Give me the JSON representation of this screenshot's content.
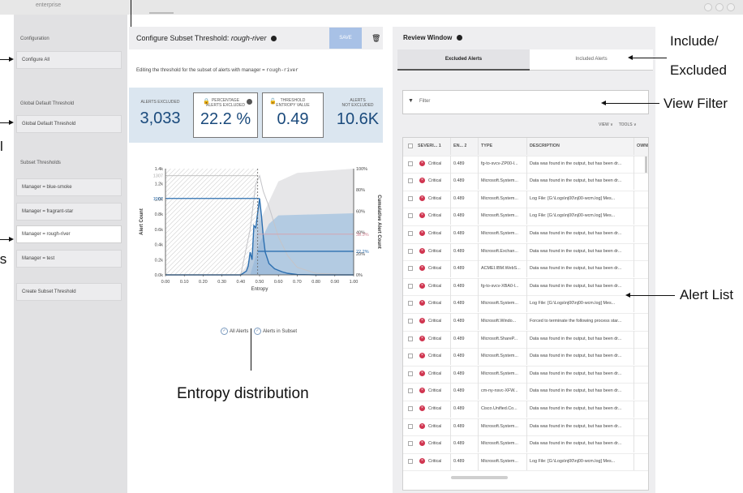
{
  "brand": "enterprise",
  "sidebar": {
    "config_heading": "Configuration",
    "configure_all": "Configure All",
    "global_heading": "Global Default Threshold",
    "global_button": "Global Default Threshold",
    "subset_heading": "Subset Thresholds",
    "subsets": [
      "Manager = blue-smoke",
      "Manager = fragrant-star",
      "Manager = rough-river",
      "Manager = test"
    ],
    "create_subset": "Create Subset Threshold"
  },
  "main": {
    "title_prefix": "Configure Subset Threshold:",
    "title_subset": "rough-river",
    "save_label": "SAVE",
    "editing_text": "Editing the threshold for the subset of alerts with manager =",
    "editing_value": "rough-river",
    "stats": {
      "alerts_excluded_label": "ALERTS EXCLUDED",
      "alerts_excluded_value": "3,033",
      "percentage_label_1": "PERCENTAGE",
      "percentage_label_2": "ALERTS EXCLUDED",
      "percentage_value": "22.2 %",
      "threshold_label_1": "THRESHOLD",
      "threshold_label_2": "ENTROPY VALUE",
      "threshold_value": "0.49",
      "not_excluded_label_1": "ALERTS",
      "not_excluded_label_2": "NOT EXCLUDED",
      "not_excluded_value": "10.6K"
    },
    "legend": {
      "all_alerts": "All Alerts",
      "alerts_in_subset": "Alerts in Subset"
    }
  },
  "chart_data": {
    "type": "area",
    "xlabel": "Entropy",
    "ylabel_left": "Alert Count",
    "ylabel_right": "Cumulative Alert Count",
    "x_ticks": [
      "0.00",
      "0.10",
      "0.20",
      "0.30",
      "0.40",
      "0.50",
      "0.60",
      "0.70",
      "0.80",
      "0.90",
      "1.00"
    ],
    "y_ticks_left": [
      "0.0k",
      "0.2k",
      "0.4k",
      "0.6k",
      "0.8k",
      "1.0k",
      "1.2k",
      "1.4k"
    ],
    "y_ticks_right": [
      "0%",
      "20%",
      "40%",
      "60%",
      "80%",
      "100%"
    ],
    "ylim_left": [
      0,
      1400
    ],
    "ylim_right": [
      0,
      100
    ],
    "xlim": [
      0,
      1
    ],
    "threshold_x": 0.49,
    "markers": {
      "left_1": "1307",
      "left_2": "1007",
      "right_1": "38.3%",
      "right_2": "22.2%"
    },
    "series": [
      {
        "name": "Alerts in Subset",
        "x": [
          0.0,
          0.4,
          0.43,
          0.44,
          0.45,
          0.46,
          0.47,
          0.48,
          0.49,
          0.5,
          0.51,
          0.52,
          0.53,
          0.55,
          0.58,
          0.62,
          0.65,
          0.7,
          0.8,
          1.0
        ],
        "values": [
          0,
          0,
          50,
          120,
          300,
          200,
          650,
          620,
          820,
          1007,
          780,
          500,
          300,
          150,
          80,
          40,
          20,
          5,
          0,
          0
        ]
      },
      {
        "name": "All Alerts",
        "x": [
          0.0,
          0.4,
          0.45,
          0.48,
          0.5,
          0.52,
          0.55,
          0.6,
          0.65,
          0.7,
          0.8,
          1.0
        ],
        "values": [
          0,
          0,
          600,
          1200,
          1307,
          1100,
          900,
          500,
          250,
          100,
          20,
          0
        ]
      }
    ]
  },
  "review": {
    "title": "Review Window",
    "tab_excluded": "Excluded Alerts",
    "tab_included": "Included Alerts",
    "filter_placeholder": "Filter",
    "view_label": "VIEW",
    "tools_label": "TOOLS",
    "columns": [
      "SEVERI... 1",
      "EN... 2",
      "TYPE",
      "DESCRIPTION",
      "OWNED"
    ],
    "rows": [
      {
        "sev": "Critical",
        "en": "0.489",
        "type": "fg-to-svcv-ZP00-l...",
        "desc": "Data was found in the output, but has been dr..."
      },
      {
        "sev": "Critical",
        "en": "0.489",
        "type": "Microsoft.System...",
        "desc": "Data was found in the output, but has been dr..."
      },
      {
        "sev": "Critical",
        "en": "0.489",
        "type": "Microsoft.System...",
        "desc": "Log File: [G:\\Logs\\nj00\\nj00-wcm.log] Mes..."
      },
      {
        "sev": "Critical",
        "en": "0.489",
        "type": "Microsoft.System...",
        "desc": "Log File: [G:\\Logs\\nj00\\nj00-wcm.log] Mes..."
      },
      {
        "sev": "Critical",
        "en": "0.489",
        "type": "Microsoft.System...",
        "desc": "Data was found in the output, but has been dr..."
      },
      {
        "sev": "Critical",
        "en": "0.489",
        "type": "Microsoft.Exchan...",
        "desc": "Data was found in the output, but has been dr..."
      },
      {
        "sev": "Critical",
        "en": "0.489",
        "type": "ACMEI.IBM.WebS...",
        "desc": "Data was found in the output, but has been dr..."
      },
      {
        "sev": "Critical",
        "en": "0.489",
        "type": "fg-to-svcv-XBA0-l...",
        "desc": "Data was found in the output, but has been dr..."
      },
      {
        "sev": "Critical",
        "en": "0.489",
        "type": "Microsoft.System...",
        "desc": "Log File: [G:\\Logs\\nj00\\nj00-wcm.log] Mes..."
      },
      {
        "sev": "Critical",
        "en": "0.489",
        "type": "Microsoft.Windo...",
        "desc": "Forced to terminate the following process star..."
      },
      {
        "sev": "Critical",
        "en": "0.489",
        "type": "Microsoft.ShareP...",
        "desc": "Data was found in the output, but has been dr..."
      },
      {
        "sev": "Critical",
        "en": "0.489",
        "type": "Microsoft.System...",
        "desc": "Data was found in the output, but has been dr..."
      },
      {
        "sev": "Critical",
        "en": "0.489",
        "type": "Microsoft.System...",
        "desc": "Data was found in the output, but has been dr..."
      },
      {
        "sev": "Critical",
        "en": "0.489",
        "type": "cm-ny-nsvc-XFW...",
        "desc": "Data was found in the output, but has been dr..."
      },
      {
        "sev": "Critical",
        "en": "0.489",
        "type": "Cisco.Unified.Co...",
        "desc": "Data was found in the output, but has been dr..."
      },
      {
        "sev": "Critical",
        "en": "0.489",
        "type": "Microsoft.System...",
        "desc": "Data was found in the output, but has been dr..."
      },
      {
        "sev": "Critical",
        "en": "0.489",
        "type": "Microsoft.System...",
        "desc": "Data was found in the output, but has been dr..."
      },
      {
        "sev": "Critical",
        "en": "0.489",
        "type": "Microsoft.System...",
        "desc": "Log File: [G:\\Logs\\nj00\\nj00-wcm.log] Mes..."
      }
    ]
  },
  "annotations": {
    "include_excluded_1": "Include/",
    "include_excluded_2": "Excluded",
    "view_filter": "View Filter",
    "alert_list": "Alert List",
    "entropy_distribution": "Entropy distribution",
    "left_cut_1": "l",
    "left_cut_2": "ls"
  }
}
